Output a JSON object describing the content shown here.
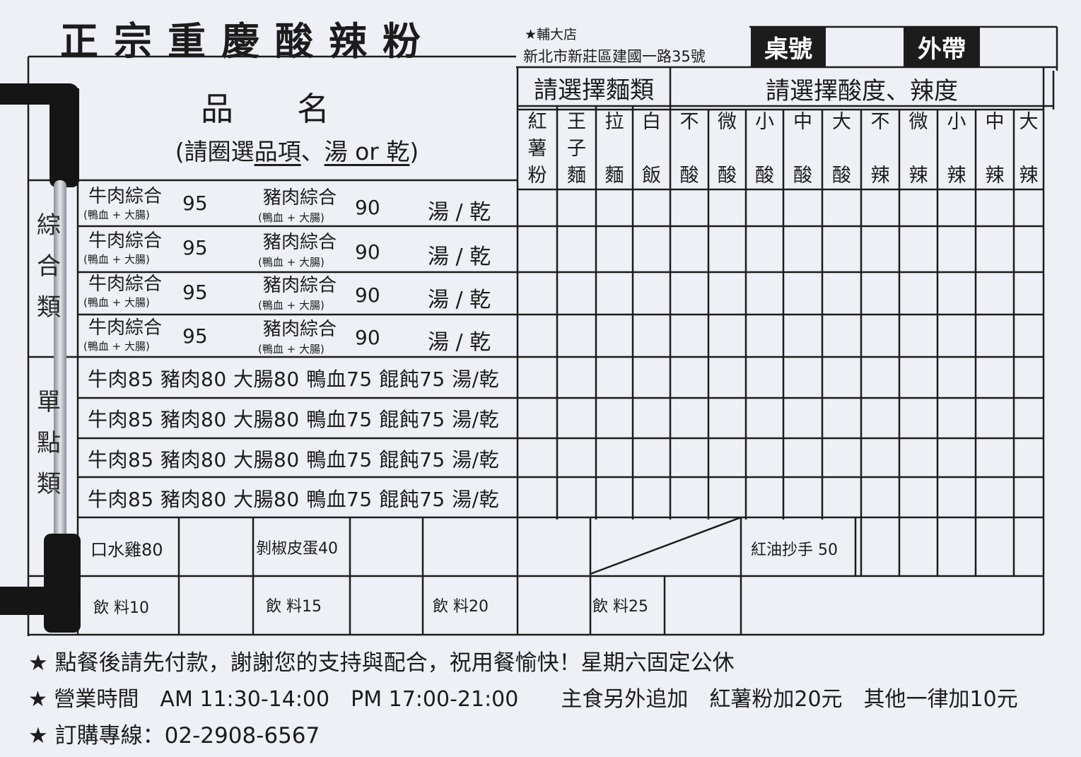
{
  "header": {
    "title": "正宗重慶酸辣粉",
    "branch": "★輔大店",
    "address": "新北市新莊區建國一路35號",
    "table_label": "桌號",
    "takeout_label": "外帶"
  },
  "item_header": {
    "title": "品名",
    "sub_prefix": "(請圈選",
    "sub_u1": "品項",
    "sub_mid": "、",
    "sub_u2": "湯 or 乾",
    "sub_suffix": ")"
  },
  "noodle_header": "請選擇麵類",
  "level_header": "請選擇酸度、辣度",
  "noodle_types": [
    "紅薯粉",
    "王子麵",
    "拉麵",
    "白飯"
  ],
  "sour_levels": [
    "不酸",
    "微酸",
    "小酸",
    "中酸",
    "大酸"
  ],
  "spicy_levels": [
    "不辣",
    "微辣",
    "小辣",
    "中辣",
    "大辣"
  ],
  "categories": {
    "combo": "綜合類",
    "single": "單點類"
  },
  "combo_rows": [
    {
      "beef": "牛肉綜合",
      "beef_note": "(鴨血 + 大腸)",
      "beef_price": "95",
      "pork": "豬肉綜合",
      "pork_note": "(鴨血 + 大腸)",
      "pork_price": "90",
      "soup": "湯 / 乾"
    },
    {
      "beef": "牛肉綜合",
      "beef_note": "(鴨血 + 大腸)",
      "beef_price": "95",
      "pork": "豬肉綜合",
      "pork_note": "(鴨血 + 大腸)",
      "pork_price": "90",
      "soup": "湯 / 乾"
    },
    {
      "beef": "牛肉綜合",
      "beef_note": "(鴨血 + 大腸)",
      "beef_price": "95",
      "pork": "豬肉綜合",
      "pork_note": "(鴨血 + 大腸)",
      "pork_price": "90",
      "soup": "湯 / 乾"
    },
    {
      "beef": "牛肉綜合",
      "beef_note": "(鴨血 + 大腸)",
      "beef_price": "95",
      "pork": "豬肉綜合",
      "pork_note": "(鴨血 + 大腸)",
      "pork_price": "90",
      "soup": "湯 / 乾"
    }
  ],
  "single_rows": [
    "牛肉85 豬肉80 大腸80 鴨血75 餛飩75 湯/乾",
    "牛肉85 豬肉80 大腸80 鴨血75 餛飩75 湯/乾",
    "牛肉85 豬肉80 大腸80 鴨血75 餛飩75 湯/乾",
    "牛肉85 豬肉80 大腸80 鴨血75 餛飩75 湯/乾"
  ],
  "sides": {
    "chicken": "口水雞80",
    "egg": "剝椒皮蛋40",
    "wonton": "紅油抄手 50",
    "drink10": "飲 料10",
    "drink15": "飲 料15",
    "drink20": "飲 料20",
    "drink25": "飲 料25"
  },
  "footer": {
    "note1": "★ 點餐後請先付款，謝謝您的支持與配合，祝用餐愉快！星期六固定公休",
    "note2": "★ 營業時間　AM 11:30-14:00　PM 17:00-21:00　　主食另外追加　紅薯粉加20元　其他一律加10元",
    "note3": "★ 訂購專線：02-2908-6567"
  },
  "colors": {
    "paper": "#eef0f6",
    "ink": "#1c1c1c",
    "binder": "#151515",
    "ring": "#b8bcc4"
  }
}
